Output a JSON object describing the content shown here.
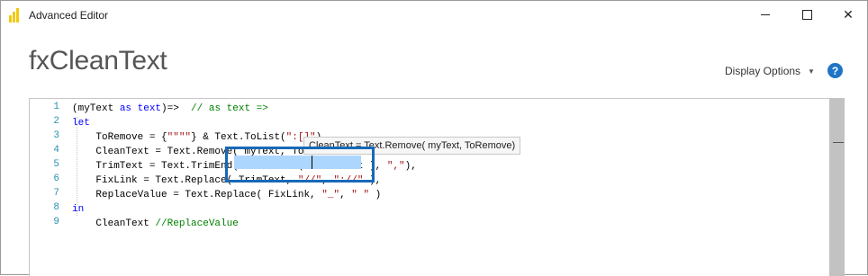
{
  "window": {
    "title": "Advanced Editor",
    "minimize_label": "—",
    "maximize_label": "□",
    "close_label": "✕"
  },
  "header": {
    "query_name": "fxCleanText",
    "display_options_label": "Display Options",
    "help_label": "?"
  },
  "editor": {
    "line_numbers": [
      "1",
      "2",
      "3",
      "4",
      "5",
      "6",
      "7",
      "8",
      "9"
    ],
    "lines": [
      [
        {
          "t": "(myText ",
          "c": ""
        },
        {
          "t": "as",
          "c": "kw"
        },
        {
          "t": " ",
          "c": ""
        },
        {
          "t": "text",
          "c": "kw"
        },
        {
          "t": ")=>  ",
          "c": ""
        },
        {
          "t": "// as text =>",
          "c": "cm"
        }
      ],
      [
        {
          "t": "let",
          "c": "kw"
        }
      ],
      [
        {
          "t": "    ToRemove = {",
          "c": ""
        },
        {
          "t": "\"\"\"\"",
          "c": "str"
        },
        {
          "t": "} & Text.ToList(",
          "c": ""
        },
        {
          "t": "\":[]\"",
          "c": "str"
        },
        {
          "t": "),",
          "c": ""
        }
      ],
      [
        {
          "t": "    CleanText = Text.Remove( myText, ToR",
          "c": ""
        }
      ],
      [
        {
          "t": "    TrimText = Text.TrimEnd( Text.Trim( CleanText ), ",
          "c": ""
        },
        {
          "t": "\",\"",
          "c": "str"
        },
        {
          "t": "),",
          "c": ""
        }
      ],
      [
        {
          "t": "    FixLink = Text.Replace( TrimText, ",
          "c": ""
        },
        {
          "t": "\"//\"",
          "c": "str"
        },
        {
          "t": ", ",
          "c": ""
        },
        {
          "t": "\"://\"",
          "c": "str"
        },
        {
          "t": " ),",
          "c": ""
        }
      ],
      [
        {
          "t": "    ReplaceValue = Text.Replace( FixLink, ",
          "c": ""
        },
        {
          "t": "\"_\"",
          "c": "str"
        },
        {
          "t": ", ",
          "c": ""
        },
        {
          "t": "\" \"",
          "c": "str"
        },
        {
          "t": " )",
          "c": ""
        }
      ],
      [
        {
          "t": "in",
          "c": "kw"
        }
      ],
      [
        {
          "t": "    CleanText ",
          "c": ""
        },
        {
          "t": "//ReplaceValue",
          "c": "cm"
        }
      ]
    ],
    "tooltip": "CleanText = Text.Remove( myText, ToRemove)"
  }
}
